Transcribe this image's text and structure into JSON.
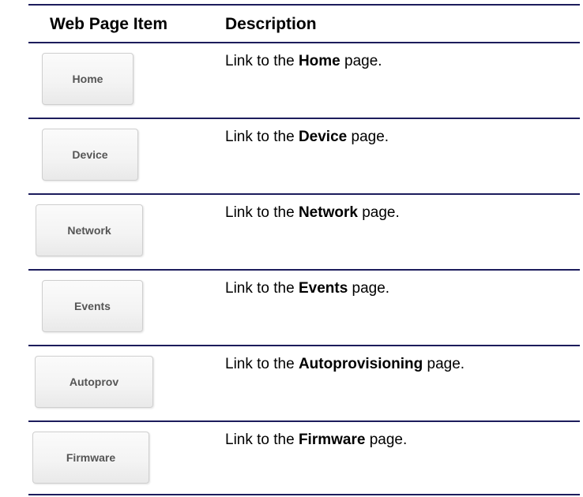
{
  "header": {
    "col_item": "Web Page Item",
    "col_description": "Description"
  },
  "rows": [
    {
      "button_label": "Home",
      "desc_prefix": "Link to the ",
      "desc_bold": "Home",
      "desc_suffix": " page."
    },
    {
      "button_label": "Device",
      "desc_prefix": "Link to the ",
      "desc_bold": "Device",
      "desc_suffix": " page."
    },
    {
      "button_label": "Network",
      "desc_prefix": "Link to the ",
      "desc_bold": "Network",
      "desc_suffix": " page."
    },
    {
      "button_label": "Events",
      "desc_prefix": "Link to the ",
      "desc_bold": "Events",
      "desc_suffix": " page."
    },
    {
      "button_label": "Autoprov",
      "desc_prefix": "Link to the ",
      "desc_bold": "Autoprovisioning",
      "desc_suffix": " page."
    },
    {
      "button_label": "Firmware",
      "desc_prefix": "Link to the ",
      "desc_bold": "Firmware",
      "desc_suffix": " page."
    }
  ],
  "colors": {
    "rule": "#1c1c5c",
    "button_text": "#555555",
    "button_border": "#cfcfcf"
  }
}
